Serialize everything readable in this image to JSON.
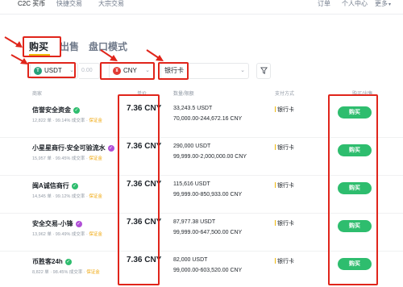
{
  "topbar": {
    "nav": [
      "C2C 买币",
      "快捷交易",
      "大宗交易"
    ],
    "right": [
      "订单",
      "个人中心",
      "更多"
    ]
  },
  "mode_tabs": [
    "购买",
    "出售",
    "盘口模式"
  ],
  "filters": {
    "coin": "USDT",
    "amount_placeholder": "0.00",
    "fiat": "CNY",
    "payment": "银行卡",
    "refresh_icon": "filter-icon"
  },
  "table": {
    "headers": [
      "商家",
      "单价",
      "数量/限额",
      "支付方式",
      "购买/出售"
    ],
    "rows": [
      {
        "merchant": "信誉安全资金",
        "stats": "12,822 单 · 99.14% 成交率 ·",
        "deposit": "保证金",
        "price": "7.36 CNY",
        "available": "33,243.5 USDT",
        "limit": "70,000.00-244,672.16 CNY",
        "payment": "银行卡",
        "action": "购买",
        "badge_color": "#2ebd6e"
      },
      {
        "merchant": "小星星商行-安全可验流水",
        "stats": "15,957 单 · 99.45% 成交率 ·",
        "deposit": "保证金",
        "price": "7.36 CNY",
        "available": "290,000 USDT",
        "limit": "99,999.00-2,000,000.00 CNY",
        "payment": "银行卡",
        "action": "购买",
        "badge_color": "#b04fd6"
      },
      {
        "merchant": "闽A诚信商行",
        "stats": "14,545 单 · 99.12% 成交率 ·",
        "deposit": "保证金",
        "price": "7.36 CNY",
        "available": "115,616 USDT",
        "limit": "99,999.00-850,933.00 CNY",
        "payment": "银行卡",
        "action": "购买",
        "badge_color": "#2ebd6e"
      },
      {
        "merchant": "安全交易-小锋",
        "stats": "13,962 单 · 99.49% 成交率 ·",
        "deposit": "保证金",
        "price": "7.36 CNY",
        "available": "87,977.38 USDT",
        "limit": "99,999.00-647,500.00 CNY",
        "payment": "银行卡",
        "action": "购买",
        "badge_color": "#b04fd6"
      },
      {
        "merchant": "币胜客24h",
        "stats": "8,822 单 · 98.45% 成交率 ·",
        "deposit": "保证金",
        "price": "7.36 CNY",
        "available": "82,000 USDT",
        "limit": "99,000.00-603,520.00 CNY",
        "payment": "银行卡",
        "action": "购买",
        "badge_color": "#2ebd6e"
      }
    ]
  },
  "colors": {
    "highlight": "#e0251b",
    "buy_green": "#2ebd6e",
    "deposit_gold": "#f0a70a",
    "usdt_green": "#26a17b",
    "cny_red": "#e23b34"
  }
}
